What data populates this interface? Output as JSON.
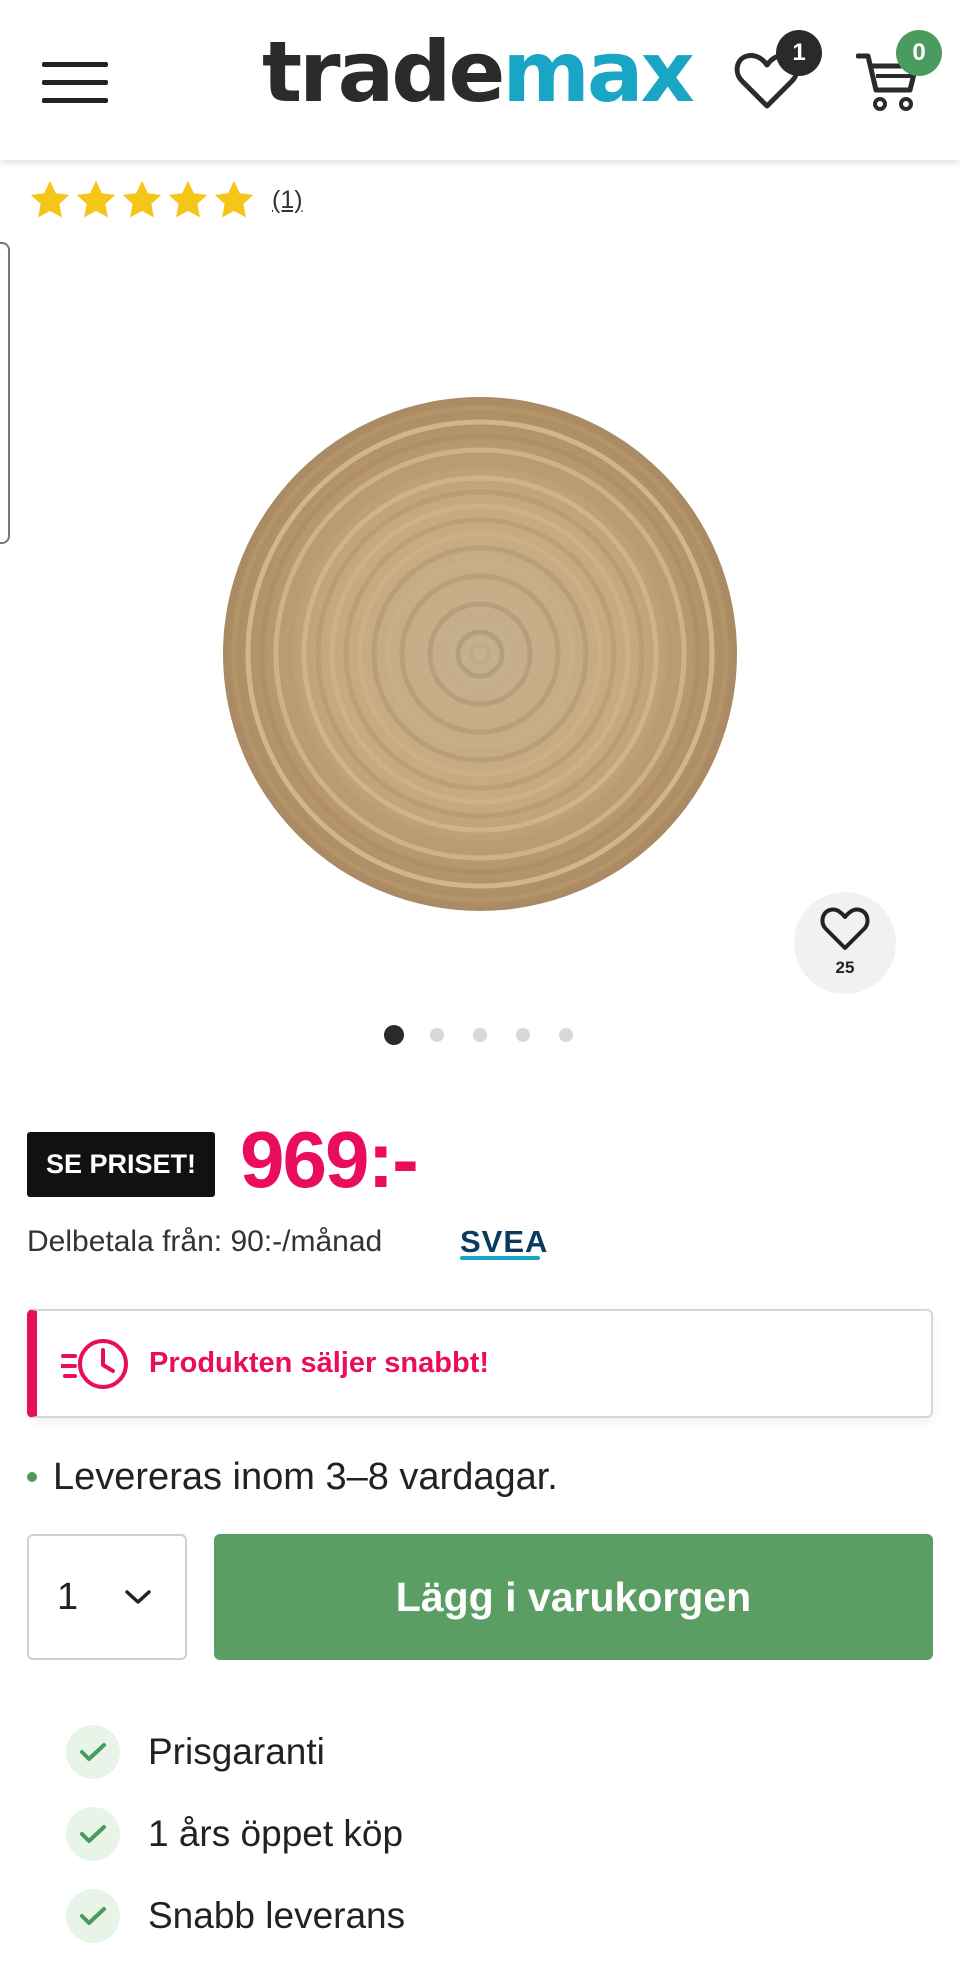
{
  "header": {
    "logo_part1": "trade",
    "logo_part2": "max",
    "wishlist_count": "1",
    "cart_count": "0"
  },
  "rating": {
    "stars": 5,
    "count_label": "(1)"
  },
  "product": {
    "image_favorites": "25",
    "gallery_total": 5,
    "gallery_active": 1
  },
  "price": {
    "tag_label": "SE PRISET!",
    "amount": "969:-",
    "installment": "Delbetala från: 90:-/månad",
    "partner": "SVEA"
  },
  "alert": {
    "text": "Produkten säljer snabbt!"
  },
  "delivery": {
    "text": "Levereras inom 3–8 vardagar."
  },
  "purchase": {
    "quantity": "1",
    "add_to_cart": "Lägg i varukorgen"
  },
  "usps": [
    {
      "label": "Prisgaranti"
    },
    {
      "label": "1 års öppet köp"
    },
    {
      "label": "Snabb leverans"
    }
  ],
  "colors": {
    "brand_dark": "#2b2b2b",
    "brand_teal": "#18a6c4",
    "price_pink": "#ea0d5e",
    "cta_green": "#5a9e63",
    "star_yellow": "#f5c518"
  }
}
